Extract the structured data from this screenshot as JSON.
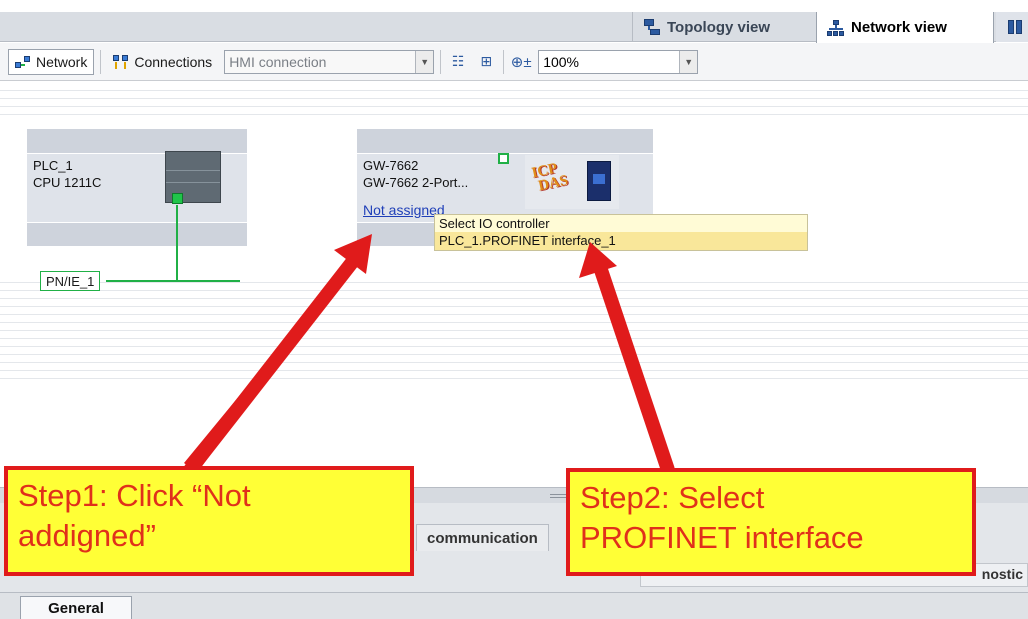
{
  "view_tabs": {
    "topology": "Topology view",
    "network": "Network view"
  },
  "toolbar": {
    "network_label": "Network",
    "connections_label": "Connections",
    "connection_type": "HMI connection",
    "zoom": "100%"
  },
  "devices": {
    "plc": {
      "name": "PLC_1",
      "model": "CPU 1211C"
    },
    "gateway": {
      "name": "GW-7662",
      "model": "GW-7662  2-Port...",
      "assignment_link": "Not assigned",
      "logo_text": "ICP DAS"
    }
  },
  "subnet": {
    "label": "PN/IE_1"
  },
  "popup": {
    "header": "Select IO controller",
    "item": "PLC_1.PROFINET interface_1"
  },
  "lower_panel": {
    "tab_fragment": "communication",
    "inspector_fragment": "nostic",
    "general_tab": "General"
  },
  "annotations": {
    "step1_line1": "Step1: Click “Not",
    "step1_line2": "addigned”",
    "step2_line1": "Step2: Select",
    "step2_line2": "PROFINET interface",
    "accent_color": "#e01b1b",
    "callout_bg": "#ffff36"
  },
  "icons": [
    "topology-icon",
    "network-view-icon",
    "device-view-icon",
    "network-icon",
    "connections-icon",
    "show-address-icon",
    "grid-icon",
    "zoom-icon"
  ]
}
